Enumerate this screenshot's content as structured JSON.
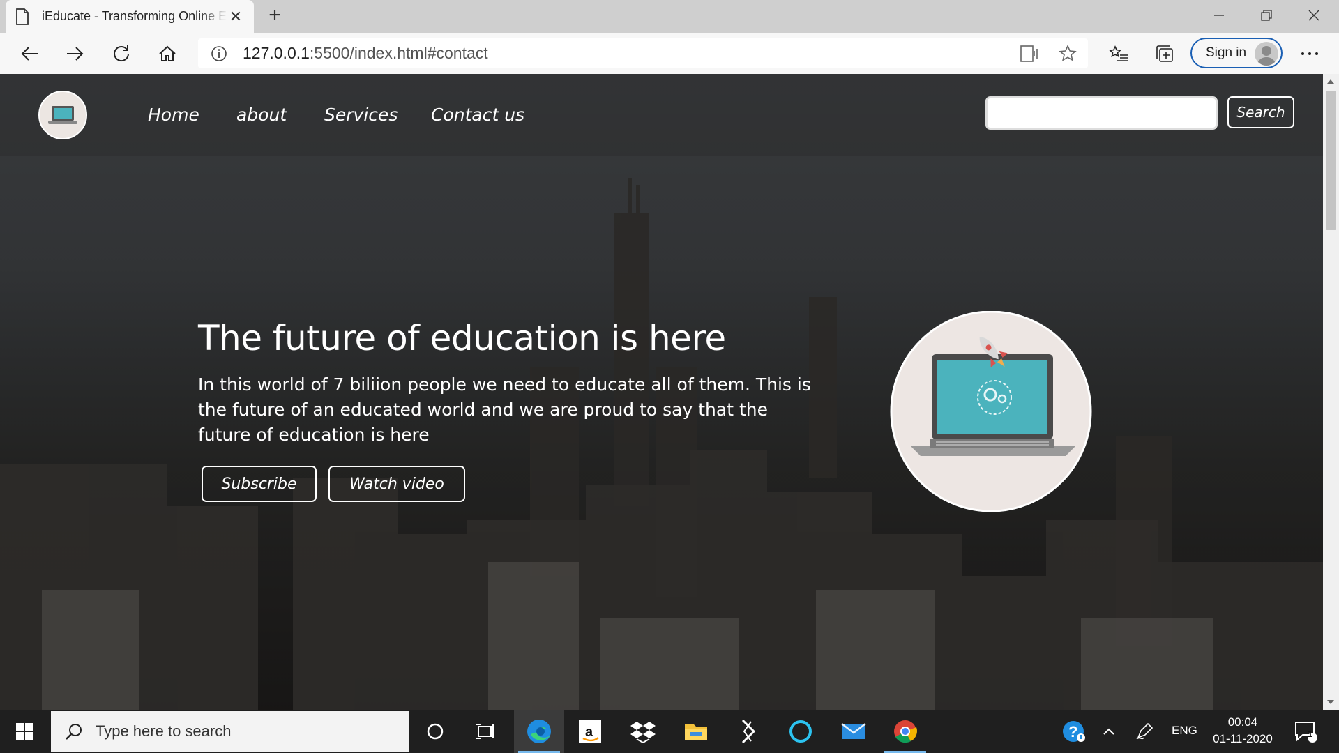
{
  "browser": {
    "tab_title": "iEducate - Transforming Online Education",
    "url_host": "127.0.0.1",
    "url_rest": ":5500/index.html#contact",
    "signin_label": "Sign in"
  },
  "site": {
    "nav": [
      "Home",
      "about",
      "Services",
      "Contact us"
    ],
    "search_button": "Search",
    "search_placeholder": "",
    "hero_title": "The future of education is here",
    "hero_text": "In this world of 7 biliion people we need to educate all of them. This is the future of an educated world and we are proud to say that the future of education is here",
    "buttons": {
      "subscribe": "Subscribe",
      "watch_video": "Watch video"
    }
  },
  "taskbar": {
    "search_placeholder": "Type here to search",
    "language": "ENG",
    "time": "00:04",
    "date": "01-11-2020",
    "notification_count": "1"
  },
  "icons": {
    "tab": "document-icon",
    "back": "back-arrow-icon",
    "forward": "forward-arrow-icon",
    "refresh": "refresh-icon",
    "home": "home-icon",
    "site_info": "info-icon",
    "read_aloud": "read-aloud-icon",
    "favorite": "star-icon",
    "favorites": "favorites-list-icon",
    "collections": "collections-icon",
    "more": "ellipsis-icon"
  },
  "colors": {
    "signin_border": "#1a5fb4",
    "taskbar": "#1f1f1f",
    "laptop_screen": "#4bb3bd"
  }
}
